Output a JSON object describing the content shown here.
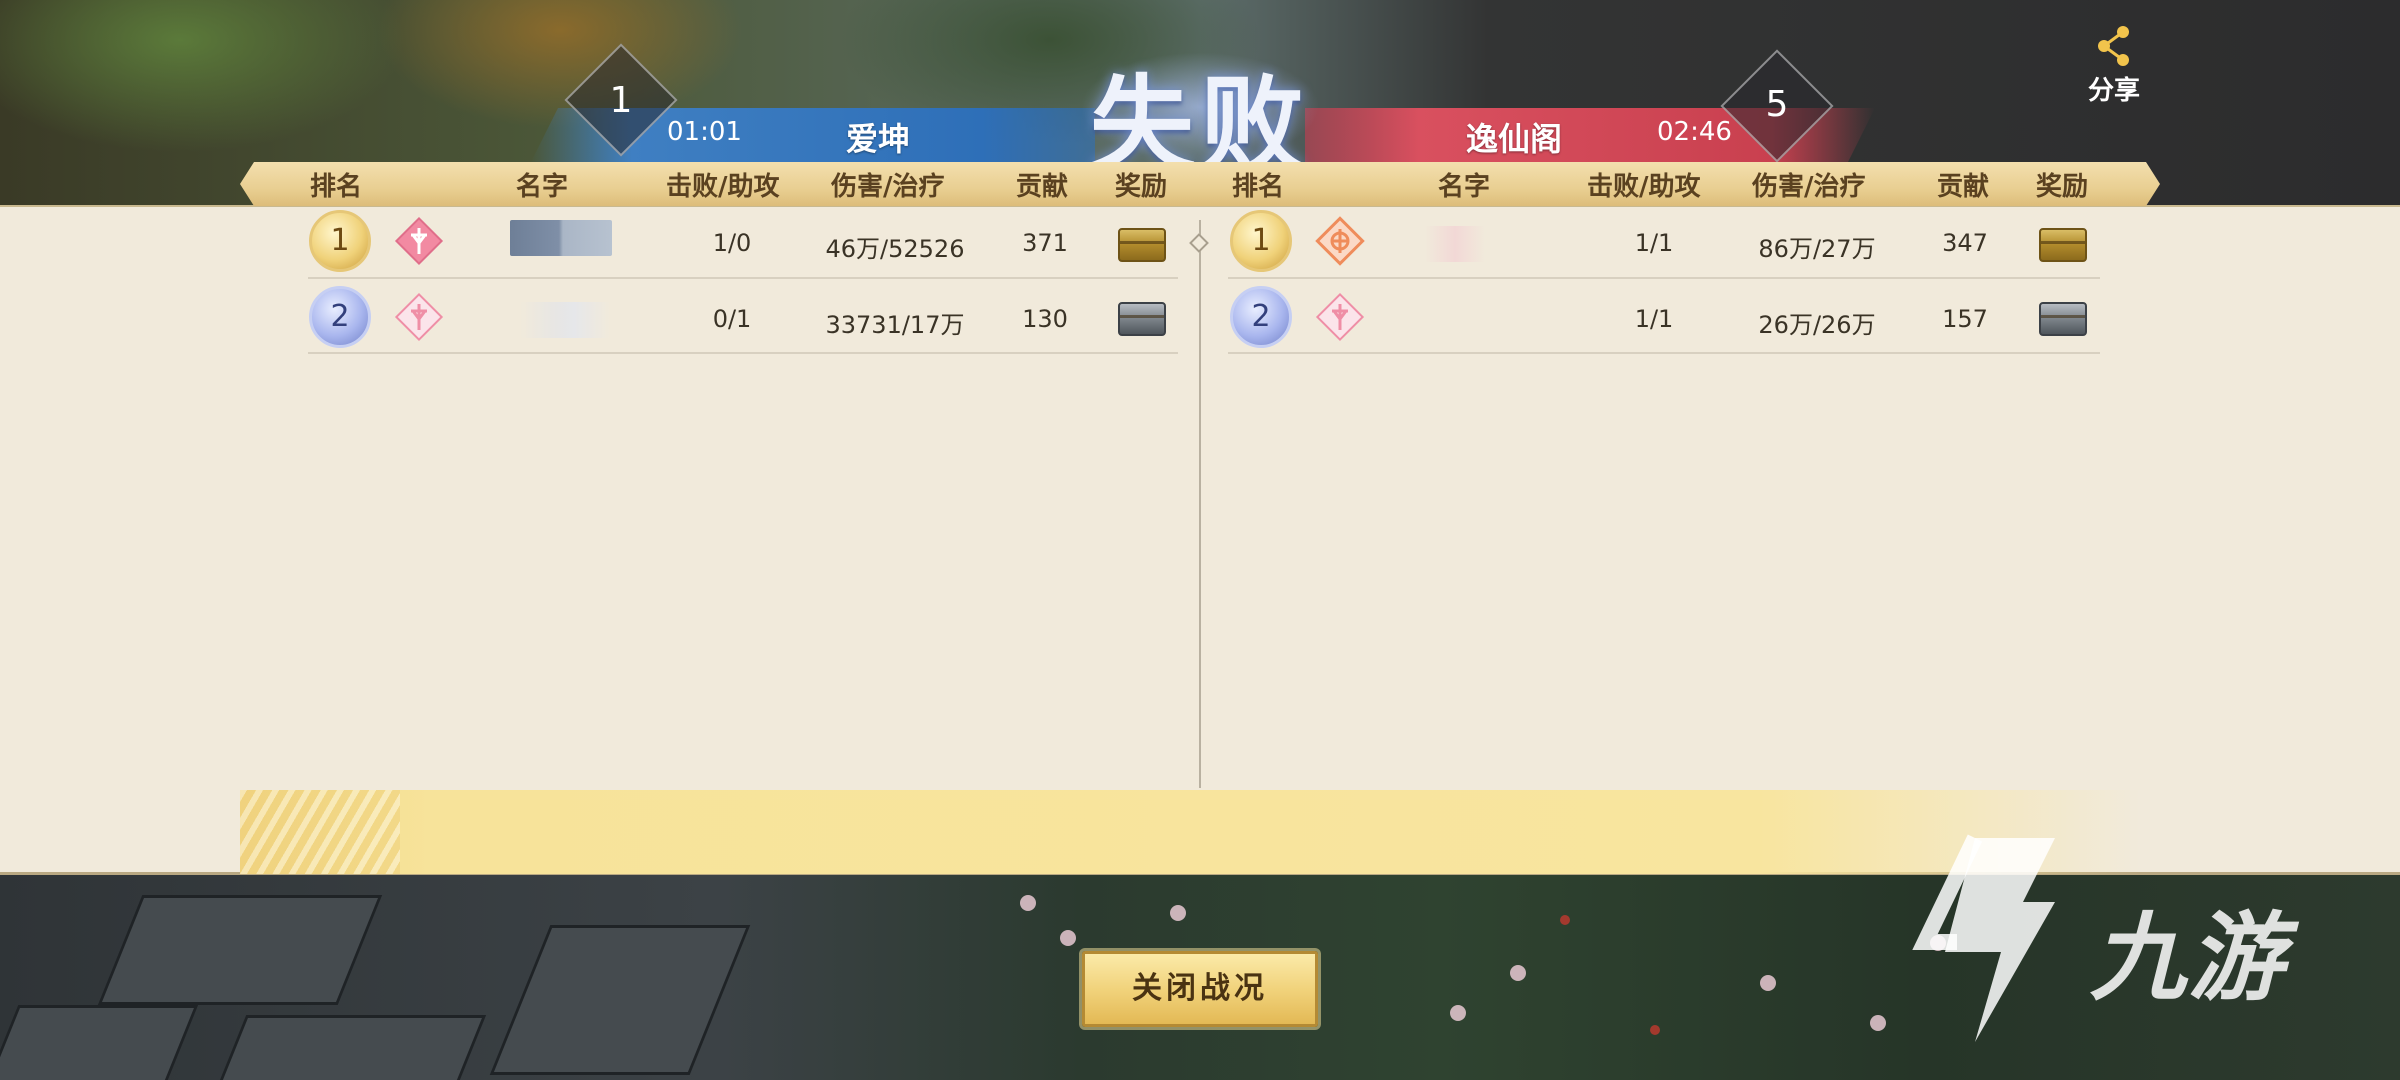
{
  "result": {
    "title": "失败"
  },
  "share": {
    "label": "分享",
    "icon": "share-icon"
  },
  "left_team": {
    "name": "爱坤",
    "time": "01:01",
    "score": "1",
    "color": "#2e6fb8"
  },
  "right_team": {
    "name": "逸仙阁",
    "time": "02:46",
    "score": "5",
    "color": "#c9404f"
  },
  "columns": {
    "rank": "排名",
    "name": "名字",
    "kda": "击败/助攻",
    "damage_heal": "伤害/治疗",
    "contribution": "贡献",
    "reward": "奖励"
  },
  "left_rows": [
    {
      "rank": "1",
      "class_icon": "class-emblem-pink-icon",
      "kda": "1/0",
      "damage_heal": "46万/52526",
      "contribution": "371",
      "reward_icon": "gold-chest-icon"
    },
    {
      "rank": "2",
      "class_icon": "class-emblem-pink-icon",
      "kda": "0/1",
      "damage_heal": "33731/17万",
      "contribution": "130",
      "reward_icon": "silver-chest-icon"
    }
  ],
  "right_rows": [
    {
      "rank": "1",
      "class_icon": "class-emblem-orange-icon",
      "kda": "1/1",
      "damage_heal": "86万/27万",
      "contribution": "347",
      "reward_icon": "gold-chest-icon"
    },
    {
      "rank": "2",
      "class_icon": "class-emblem-pink-icon",
      "kda": "1/1",
      "damage_heal": "26万/26万",
      "contribution": "157",
      "reward_icon": "silver-chest-icon"
    }
  ],
  "close_button": {
    "label": "关闭战况"
  },
  "watermark": {
    "text": "九游"
  }
}
